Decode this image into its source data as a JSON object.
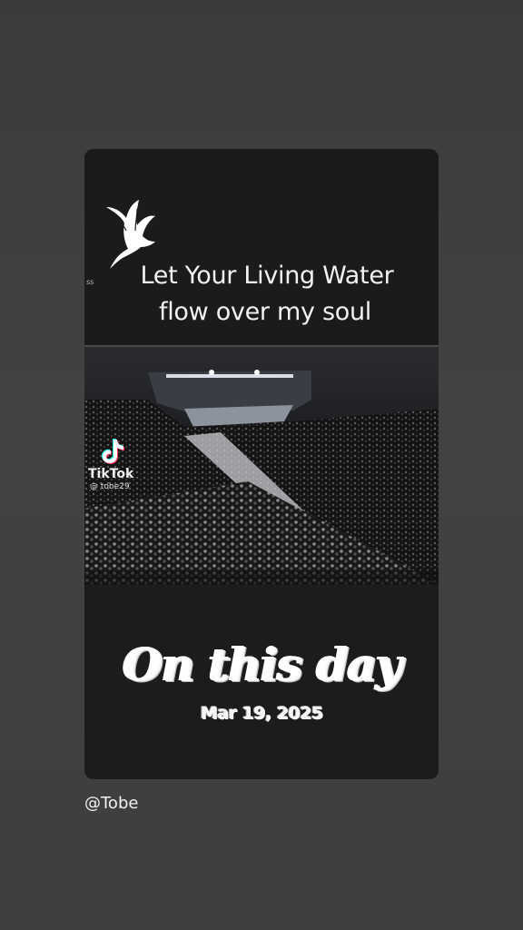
{
  "story": {
    "caption_line1": "Let Your Living Water",
    "caption_line2": "flow over my soul",
    "small_mark": "ss",
    "tiktok": {
      "name": "TikTok",
      "handle": "@ tobe29"
    },
    "memory_title": "On this day",
    "memory_date": "Mar 19, 2025"
  },
  "footer": {
    "username": "@Tobe"
  },
  "icons": {
    "dove": "dove-icon",
    "tiktok": "tiktok-logo-icon"
  },
  "colors": {
    "page_background": "#404040",
    "card_background": "#1b1b1b",
    "text": "#ffffff",
    "tiktok_cyan": "#25f4ee",
    "tiktok_red": "#fe2c55"
  }
}
